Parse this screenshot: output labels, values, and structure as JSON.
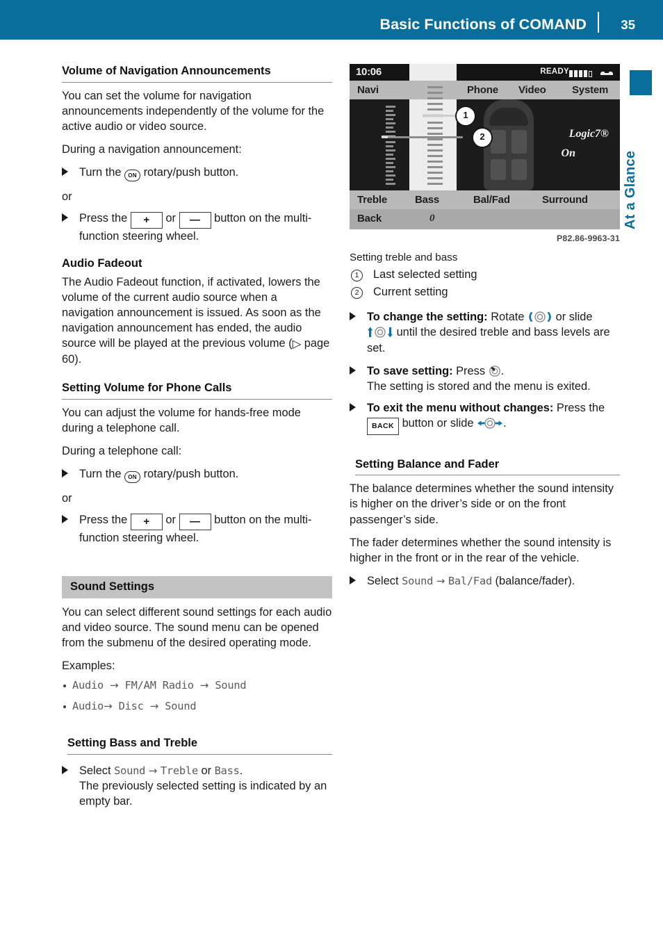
{
  "header": {
    "title": "Basic Functions of COMAND",
    "page_number": "35"
  },
  "margin_tab": {
    "label": "At a Glance",
    "color": "#0a6e9c"
  },
  "left_column": {
    "section1": {
      "heading": "Volume of Navigation Announcements",
      "paragraph1": "You can set the volume for navigation announcements independently of the volume for the active audio or video source.",
      "paragraph2": "During a navigation announcement:",
      "step1_pre": "Turn the",
      "step1_post": "rotary/push button.",
      "or": "or",
      "step2_pre": "Press the",
      "step2_mid": "or",
      "step2_post": "button on the multi-function steering wheel.",
      "knob_label": "ON",
      "plus_label": "+",
      "minus_label": "—"
    },
    "section2": {
      "heading": "Audio Fadeout",
      "paragraph1_a": "The Audio Fadeout function, if activated, lowers the volume of the current audio source when a navigation announcement is issued. As soon as the navigation announcement has ended, the audio source will be played at the previous volume (",
      "paragraph1_ref": "page 60",
      "paragraph1_b": ")."
    },
    "section3": {
      "heading": "Setting Volume for Phone Calls",
      "paragraph1": "You can adjust the volume for hands-free mode during a telephone call.",
      "paragraph2": "During a telephone call:",
      "step1_pre": "Turn the",
      "step1_post": "rotary/push button.",
      "or": "or",
      "step2_pre": "Press the",
      "step2_mid": "or",
      "step2_post": "button on the multi-function steering wheel.",
      "knob_label": "ON",
      "plus_label": "+",
      "minus_label": "—"
    },
    "section4": {
      "heading": "Sound Settings",
      "paragraph1": "You can select different sound settings for each audio and video source. The sound menu can be opened from the submenu of the desired operating mode.",
      "paragraph2": "Examples:",
      "examples": [
        {
          "part1": "Audio ",
          "arrow1": "→",
          "part2": " FM/AM Radio ",
          "arrow2": "→",
          "part3": " Sound"
        },
        {
          "part1": "Audio",
          "arrow1": "→",
          "part2": " Disc ",
          "arrow2": "→",
          "part3": " Sound"
        }
      ]
    },
    "section5": {
      "heading": "Setting Bass and Treble",
      "step_pre": "Select",
      "step_menu1": "Sound",
      "step_arrow": "→",
      "step_menu2": "Treble",
      "step_or": "or",
      "step_menu3": "Bass",
      "step_period": ".",
      "step_sub": "The previously selected setting is indicated by an empty bar."
    }
  },
  "right_column": {
    "figure": {
      "time": "10:06",
      "status_text": "READY",
      "signal_bars_filled": 4,
      "signal_bars_total": 5,
      "menu_top": [
        "Navi",
        "Phone",
        "Video",
        "System"
      ],
      "menu_bottom": [
        "Treble",
        "Bass",
        "Bal/Fad",
        "Surround"
      ],
      "back_label": "Back",
      "bass_value": "0",
      "logic_label": "Logic7®",
      "logic_state": "On",
      "callout_1": "1",
      "callout_2": "2",
      "image_code": "P82.86-9963-31"
    },
    "caption": "Setting treble and bass",
    "callouts": [
      {
        "num": "1",
        "text": "Last selected setting"
      },
      {
        "num": "2",
        "text": "Current setting"
      }
    ],
    "steps": {
      "change_lead": "To change the setting:",
      "change_text_a": "Rotate",
      "change_text_b": "or slide",
      "change_text_c": "until the desired treble and bass levels are set.",
      "save_lead": "To save setting:",
      "save_text": "Press",
      "save_period": ".",
      "save_sub": "The setting is stored and the menu is exited.",
      "exit_lead": "To exit the menu without changes:",
      "exit_text_a": "Press the",
      "exit_button": "BACK",
      "exit_text_b": "button or slide",
      "exit_period": "."
    },
    "section_balance": {
      "heading": "Setting Balance and Fader",
      "paragraph1": "The balance determines whether the sound intensity is higher on the driver’s side or on the front passenger’s side.",
      "paragraph2": "The fader determines whether the sound intensity is higher in the front or in the rear of the vehicle.",
      "step_pre": "Select",
      "step_menu1": "Sound",
      "step_arrow": "→",
      "step_menu2": "Bal/Fad",
      "step_post": "(balance/fader)."
    }
  },
  "colors": {
    "brand_blue": "#0a6e9c",
    "band_gray": "#c2c2c2",
    "rule_gray": "#8a8a8a",
    "mono_gray": "#595959"
  }
}
